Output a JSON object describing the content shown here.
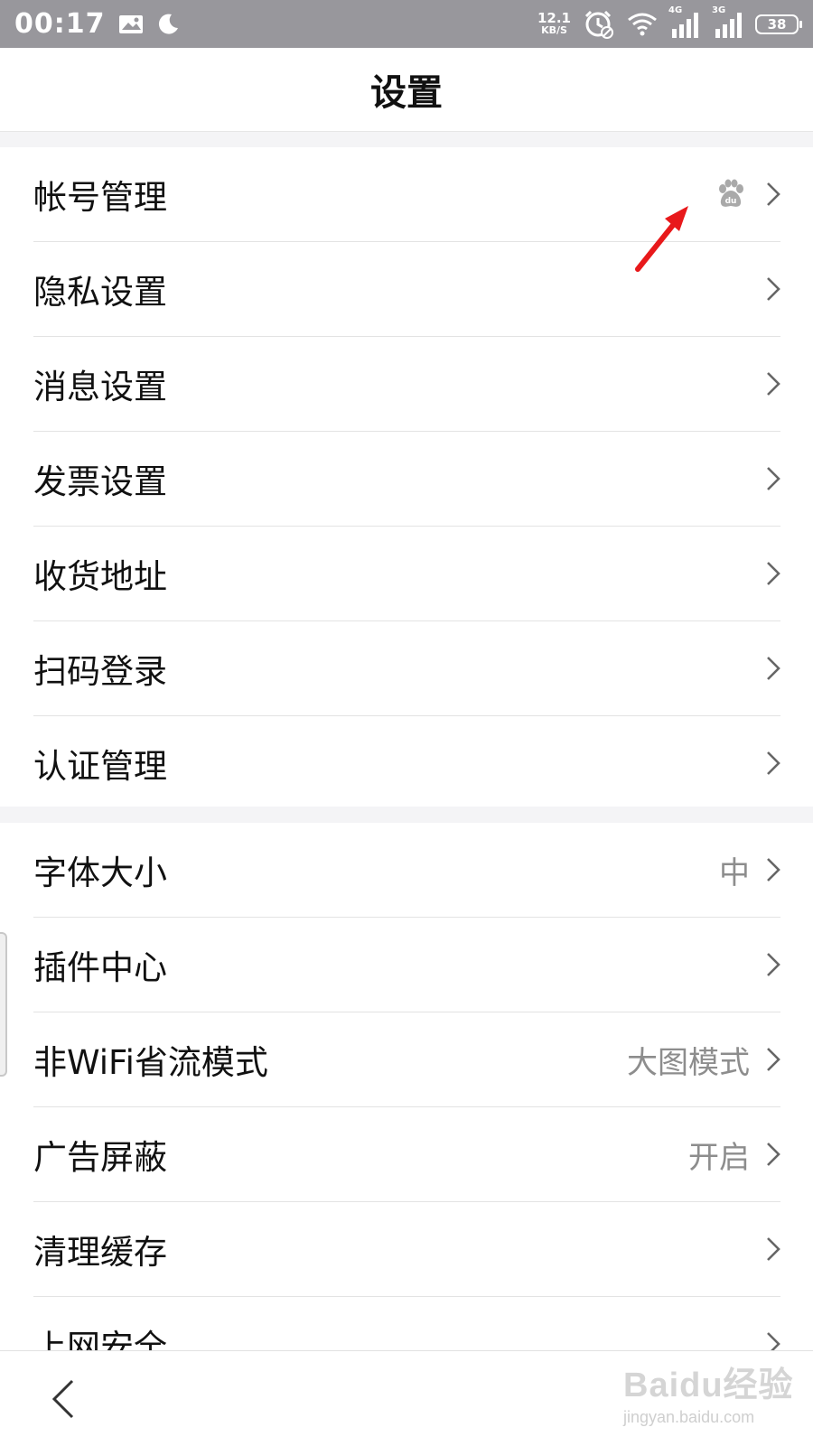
{
  "status_bar": {
    "time": "00:17",
    "net_speed_value": "12.1",
    "net_speed_unit": "KB/S",
    "signal1_tag": "4G",
    "signal2_tag": "3G",
    "battery": "38",
    "icons": [
      "image-icon",
      "moon-icon",
      "alarm-icon",
      "wifi-icon",
      "signal-icon",
      "battery-icon"
    ]
  },
  "header": {
    "title": "设置"
  },
  "groups": [
    {
      "items": [
        {
          "label": "帐号管理",
          "value": "",
          "icon": "baidu-paw-icon"
        },
        {
          "label": "隐私设置",
          "value": ""
        },
        {
          "label": "消息设置",
          "value": ""
        },
        {
          "label": "发票设置",
          "value": ""
        },
        {
          "label": "收货地址",
          "value": ""
        },
        {
          "label": "扫码登录",
          "value": ""
        },
        {
          "label": "认证管理",
          "value": ""
        }
      ]
    },
    {
      "items": [
        {
          "label": "字体大小",
          "value": "中"
        },
        {
          "label": "插件中心",
          "value": ""
        },
        {
          "label": "非WiFi省流模式",
          "value": "大图模式"
        },
        {
          "label": "广告屏蔽",
          "value": "开启"
        },
        {
          "label": "清理缓存",
          "value": ""
        },
        {
          "label": "上网安全",
          "value": ""
        }
      ]
    }
  ],
  "watermark": {
    "top": "Baidu经验",
    "bottom": "jingyan.baidu.com"
  },
  "colors": {
    "annotation_arrow": "#e8191b",
    "status_bar": "#98979c",
    "secondary_text": "#8d8d8d"
  }
}
